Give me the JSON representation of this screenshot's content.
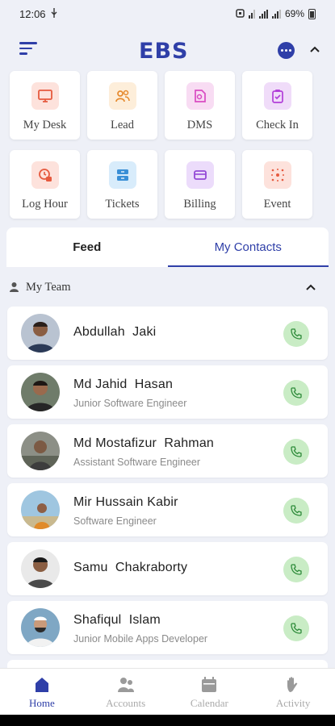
{
  "status": {
    "time": "12:06",
    "battery": "69%"
  },
  "header": {
    "logo": "EBS"
  },
  "tiles": [
    {
      "label": "My Desk",
      "icon": "monitor-icon",
      "bg": "#fde2dc",
      "color": "#e65a3f"
    },
    {
      "label": "Lead",
      "icon": "users-icon",
      "bg": "#fdeeda",
      "color": "#e68a2e"
    },
    {
      "label": "DMS",
      "icon": "document-icon",
      "bg": "#f8dcf3",
      "color": "#d94bc2"
    },
    {
      "label": "Check In",
      "icon": "clipboard-check-icon",
      "bg": "#f0dcf9",
      "color": "#b23fd9"
    },
    {
      "label": "Log Hour",
      "icon": "clock-icon",
      "bg": "#fde2dc",
      "color": "#e65a3f"
    },
    {
      "label": "Tickets",
      "icon": "ticket-icon",
      "bg": "#d8ecfb",
      "color": "#3a8fd6"
    },
    {
      "label": "Billing",
      "icon": "card-icon",
      "bg": "#ecdcfb",
      "color": "#9348d6"
    },
    {
      "label": "Event",
      "icon": "event-icon",
      "bg": "#fde2dc",
      "color": "#e65a3f"
    }
  ],
  "tabs": {
    "feed": "Feed",
    "contacts": "My Contacts"
  },
  "team": {
    "label": "My Team"
  },
  "contacts": [
    {
      "name": "Abdullah  Jaki",
      "role": ""
    },
    {
      "name": "Md Jahid  Hasan",
      "role": "Junior Software Engineer"
    },
    {
      "name": "Md Mostafizur  Rahman",
      "role": "Assistant Software Engineer"
    },
    {
      "name": "Mir Hussain Kabir",
      "role": "Software Engineer"
    },
    {
      "name": "Samu  Chakraborty",
      "role": ""
    },
    {
      "name": "Shafiqul  Islam",
      "role": "Junior Mobile Apps Developer"
    }
  ],
  "nav": {
    "home": "Home",
    "accounts": "Accounts",
    "calendar": "Calendar",
    "activity": "Activity"
  },
  "colors": {
    "brand": "#2f3fa8",
    "call_bg": "#c9ecc5",
    "call_icon": "#2e8b3a"
  }
}
